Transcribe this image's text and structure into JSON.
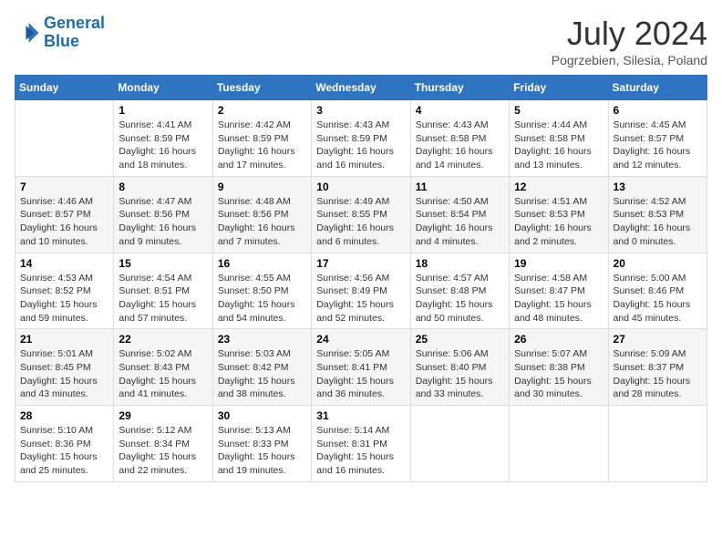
{
  "logo": {
    "line1": "General",
    "line2": "Blue"
  },
  "title": "July 2024",
  "subtitle": "Pogrzebien, Silesia, Poland",
  "weekdays": [
    "Sunday",
    "Monday",
    "Tuesday",
    "Wednesday",
    "Thursday",
    "Friday",
    "Saturday"
  ],
  "weeks": [
    [
      {
        "day": "",
        "info": ""
      },
      {
        "day": "1",
        "info": "Sunrise: 4:41 AM\nSunset: 8:59 PM\nDaylight: 16 hours\nand 18 minutes."
      },
      {
        "day": "2",
        "info": "Sunrise: 4:42 AM\nSunset: 8:59 PM\nDaylight: 16 hours\nand 17 minutes."
      },
      {
        "day": "3",
        "info": "Sunrise: 4:43 AM\nSunset: 8:59 PM\nDaylight: 16 hours\nand 16 minutes."
      },
      {
        "day": "4",
        "info": "Sunrise: 4:43 AM\nSunset: 8:58 PM\nDaylight: 16 hours\nand 14 minutes."
      },
      {
        "day": "5",
        "info": "Sunrise: 4:44 AM\nSunset: 8:58 PM\nDaylight: 16 hours\nand 13 minutes."
      },
      {
        "day": "6",
        "info": "Sunrise: 4:45 AM\nSunset: 8:57 PM\nDaylight: 16 hours\nand 12 minutes."
      }
    ],
    [
      {
        "day": "7",
        "info": "Sunrise: 4:46 AM\nSunset: 8:57 PM\nDaylight: 16 hours\nand 10 minutes."
      },
      {
        "day": "8",
        "info": "Sunrise: 4:47 AM\nSunset: 8:56 PM\nDaylight: 16 hours\nand 9 minutes."
      },
      {
        "day": "9",
        "info": "Sunrise: 4:48 AM\nSunset: 8:56 PM\nDaylight: 16 hours\nand 7 minutes."
      },
      {
        "day": "10",
        "info": "Sunrise: 4:49 AM\nSunset: 8:55 PM\nDaylight: 16 hours\nand 6 minutes."
      },
      {
        "day": "11",
        "info": "Sunrise: 4:50 AM\nSunset: 8:54 PM\nDaylight: 16 hours\nand 4 minutes."
      },
      {
        "day": "12",
        "info": "Sunrise: 4:51 AM\nSunset: 8:53 PM\nDaylight: 16 hours\nand 2 minutes."
      },
      {
        "day": "13",
        "info": "Sunrise: 4:52 AM\nSunset: 8:53 PM\nDaylight: 16 hours\nand 0 minutes."
      }
    ],
    [
      {
        "day": "14",
        "info": "Sunrise: 4:53 AM\nSunset: 8:52 PM\nDaylight: 15 hours\nand 59 minutes."
      },
      {
        "day": "15",
        "info": "Sunrise: 4:54 AM\nSunset: 8:51 PM\nDaylight: 15 hours\nand 57 minutes."
      },
      {
        "day": "16",
        "info": "Sunrise: 4:55 AM\nSunset: 8:50 PM\nDaylight: 15 hours\nand 54 minutes."
      },
      {
        "day": "17",
        "info": "Sunrise: 4:56 AM\nSunset: 8:49 PM\nDaylight: 15 hours\nand 52 minutes."
      },
      {
        "day": "18",
        "info": "Sunrise: 4:57 AM\nSunset: 8:48 PM\nDaylight: 15 hours\nand 50 minutes."
      },
      {
        "day": "19",
        "info": "Sunrise: 4:58 AM\nSunset: 8:47 PM\nDaylight: 15 hours\nand 48 minutes."
      },
      {
        "day": "20",
        "info": "Sunrise: 5:00 AM\nSunset: 8:46 PM\nDaylight: 15 hours\nand 45 minutes."
      }
    ],
    [
      {
        "day": "21",
        "info": "Sunrise: 5:01 AM\nSunset: 8:45 PM\nDaylight: 15 hours\nand 43 minutes."
      },
      {
        "day": "22",
        "info": "Sunrise: 5:02 AM\nSunset: 8:43 PM\nDaylight: 15 hours\nand 41 minutes."
      },
      {
        "day": "23",
        "info": "Sunrise: 5:03 AM\nSunset: 8:42 PM\nDaylight: 15 hours\nand 38 minutes."
      },
      {
        "day": "24",
        "info": "Sunrise: 5:05 AM\nSunset: 8:41 PM\nDaylight: 15 hours\nand 36 minutes."
      },
      {
        "day": "25",
        "info": "Sunrise: 5:06 AM\nSunset: 8:40 PM\nDaylight: 15 hours\nand 33 minutes."
      },
      {
        "day": "26",
        "info": "Sunrise: 5:07 AM\nSunset: 8:38 PM\nDaylight: 15 hours\nand 30 minutes."
      },
      {
        "day": "27",
        "info": "Sunrise: 5:09 AM\nSunset: 8:37 PM\nDaylight: 15 hours\nand 28 minutes."
      }
    ],
    [
      {
        "day": "28",
        "info": "Sunrise: 5:10 AM\nSunset: 8:36 PM\nDaylight: 15 hours\nand 25 minutes."
      },
      {
        "day": "29",
        "info": "Sunrise: 5:12 AM\nSunset: 8:34 PM\nDaylight: 15 hours\nand 22 minutes."
      },
      {
        "day": "30",
        "info": "Sunrise: 5:13 AM\nSunset: 8:33 PM\nDaylight: 15 hours\nand 19 minutes."
      },
      {
        "day": "31",
        "info": "Sunrise: 5:14 AM\nSunset: 8:31 PM\nDaylight: 15 hours\nand 16 minutes."
      },
      {
        "day": "",
        "info": ""
      },
      {
        "day": "",
        "info": ""
      },
      {
        "day": "",
        "info": ""
      }
    ]
  ]
}
